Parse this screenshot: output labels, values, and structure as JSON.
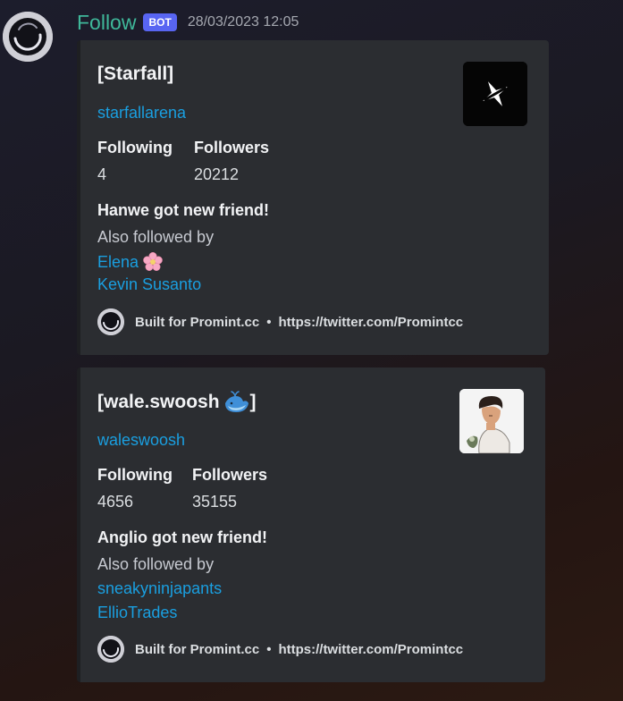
{
  "message": {
    "username": "Follow",
    "badge": "BOT",
    "timestamp": "28/03/2023 12:05",
    "avatar_icon": "ring-logo-icon"
  },
  "embeds": [
    {
      "title": "[Starfall]",
      "profile_link": "starfallarena",
      "fields": [
        {
          "name": "Following",
          "value": "4"
        },
        {
          "name": "Followers",
          "value": "20212"
        }
      ],
      "headline": "Hanwe got new friend!",
      "also_followed_label": "Also followed by",
      "friends": [
        "Elena",
        "Kevin Susanto"
      ],
      "friend_emoji": "cherry-blossom-icon",
      "thumbnail": "starfall-star-logo",
      "footer_text": "Built for Promint.cc",
      "footer_link": "https://twitter.com/Promintcc"
    },
    {
      "title": "[wale.swoosh",
      "title_end": "]",
      "title_emoji": "whale-icon",
      "profile_link": "waleswoosh",
      "fields": [
        {
          "name": "Following",
          "value": "4656"
        },
        {
          "name": "Followers",
          "value": "35155"
        }
      ],
      "headline": "Anglio got new friend!",
      "also_followed_label": "Also followed by",
      "friends": [
        "sneakyninjapants",
        "EllioTrades"
      ],
      "thumbnail": "person-avatar-illustration",
      "footer_text": "Built for Promint.cc",
      "footer_link": "https://twitter.com/Promintcc"
    }
  ],
  "colors": {
    "username": "#3fb89a",
    "badge": "#5865f2",
    "link": "#1a9fe0",
    "embed_bg": "#2b2d31"
  }
}
